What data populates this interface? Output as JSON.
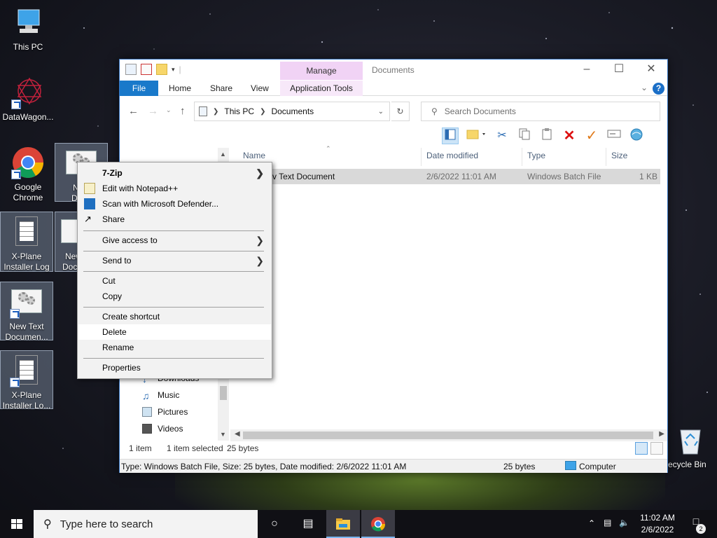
{
  "desktop": {
    "icons": [
      {
        "label_line1": "This PC",
        "label_line2": ""
      },
      {
        "label_line1": "DataWagon...",
        "label_line2": ""
      },
      {
        "label_line1": "Google",
        "label_line2": "Chrome"
      },
      {
        "label_line1": "New",
        "label_line2": "Docu"
      },
      {
        "label_line1": "X-Plane",
        "label_line2": "Installer Log"
      },
      {
        "label_line1": "New",
        "label_line2": "Doc"
      },
      {
        "label_line1": "New Text",
        "label_line2": "Documen..."
      },
      {
        "label_line1": "X-Plane",
        "label_line2": "Installer Lo..."
      },
      {
        "label_line1": "ecycle Bin",
        "label_line2": ""
      }
    ]
  },
  "explorer": {
    "title": "Documents",
    "manage_tab": "Manage",
    "ribbon_tabs": {
      "file": "File",
      "home": "Home",
      "share": "Share",
      "view": "View",
      "app_tools": "Application Tools"
    },
    "help": "?",
    "address": {
      "root": "This PC",
      "folder": "Documents"
    },
    "search_placeholder": "Search Documents",
    "columns": {
      "name": "Name",
      "date": "Date modified",
      "type": "Type",
      "size": "Size"
    },
    "files": [
      {
        "name": "v Text Document",
        "date": "2/6/2022 11:01 AM",
        "type": "Windows Batch File",
        "size": "1 KB"
      }
    ],
    "nav_items": [
      {
        "label": "Downloads"
      },
      {
        "label": "Music"
      },
      {
        "label": "Pictures"
      },
      {
        "label": "Videos"
      }
    ],
    "status": {
      "count": "1 item",
      "selected": "1 item selected",
      "bytes": "25 bytes"
    },
    "details_bar": {
      "info": "Type: Windows Batch File, Size: 25 bytes, Date modified: 2/6/2022 11:01 AM",
      "size": "25 bytes",
      "location": "Computer"
    }
  },
  "context_menu": {
    "items": [
      {
        "label": "7-Zip"
      },
      {
        "label": "Edit with Notepad++"
      },
      {
        "label": "Scan with Microsoft Defender..."
      },
      {
        "label": "Share"
      },
      {
        "label": "Give access to"
      },
      {
        "label": "Send to"
      },
      {
        "label": "Cut"
      },
      {
        "label": "Copy"
      },
      {
        "label": "Create shortcut"
      },
      {
        "label": "Delete"
      },
      {
        "label": "Rename"
      },
      {
        "label": "Properties"
      }
    ]
  },
  "taskbar": {
    "search_placeholder": "Type here to search",
    "time": "11:02 AM",
    "date": "2/6/2022",
    "notification_count": "2"
  },
  "colors": {
    "accent": "#1979ca",
    "manage_tab": "#f1d3f5",
    "taskbar": "#101015"
  }
}
